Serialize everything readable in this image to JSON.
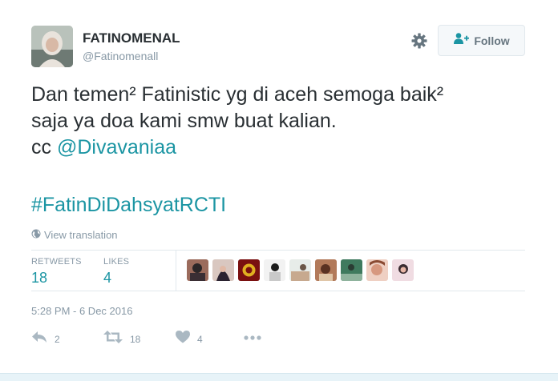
{
  "author": {
    "display_name": "FATINOMENAL",
    "handle": "@Fatinomenall"
  },
  "header": {
    "settings_icon": "gear-icon",
    "follow_label": "Follow",
    "follow_icon": "add-user-icon"
  },
  "tweet": {
    "lines": [
      "Dan temen² Fatinistic yg di aceh semoga baik²",
      "saja ya doa kami smw buat kalian."
    ],
    "cc_prefix": "cc ",
    "mention": "@Divavaniaa",
    "hashtag": "#FatinDiDahsyatRCTI"
  },
  "translation": {
    "icon": "globe-icon",
    "label": "View translation"
  },
  "stats": {
    "retweets_label": "RETWEETS",
    "retweets_count": "18",
    "likes_label": "LIKES",
    "likes_count": "4"
  },
  "likers_count_shown": 9,
  "timestamp": "5:28 PM - 6 Dec 2016",
  "actions": {
    "reply_icon": "reply-icon",
    "reply_count": "2",
    "retweet_icon": "retweet-icon",
    "retweet_count": "18",
    "like_icon": "heart-icon",
    "like_count": "4",
    "more_icon": "more-dots-icon"
  },
  "colors": {
    "link": "#1b95a3",
    "muted": "#8899a6",
    "text": "#292f33"
  }
}
